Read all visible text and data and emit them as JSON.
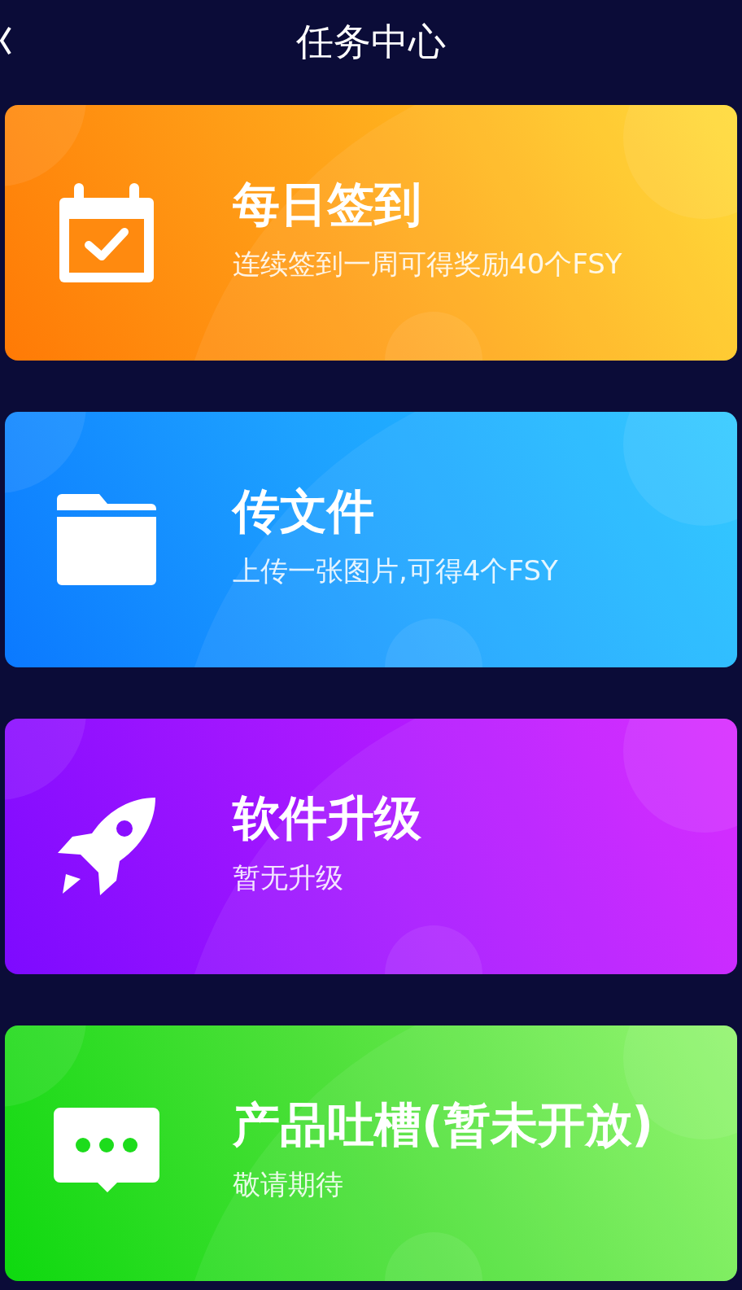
{
  "header": {
    "title": "任务中心"
  },
  "tasks": [
    {
      "kind": "checkin",
      "title": "每日签到",
      "subtitle": "连续签到一周可得奖励40个FSY"
    },
    {
      "kind": "upload",
      "title": "传文件",
      "subtitle": "上传一张图片,可得4个FSY"
    },
    {
      "kind": "upgrade",
      "title": "软件升级",
      "subtitle": "暂无升级"
    },
    {
      "kind": "feedback",
      "title": "产品吐槽(暂未开放)",
      "subtitle": "敬请期待"
    }
  ]
}
